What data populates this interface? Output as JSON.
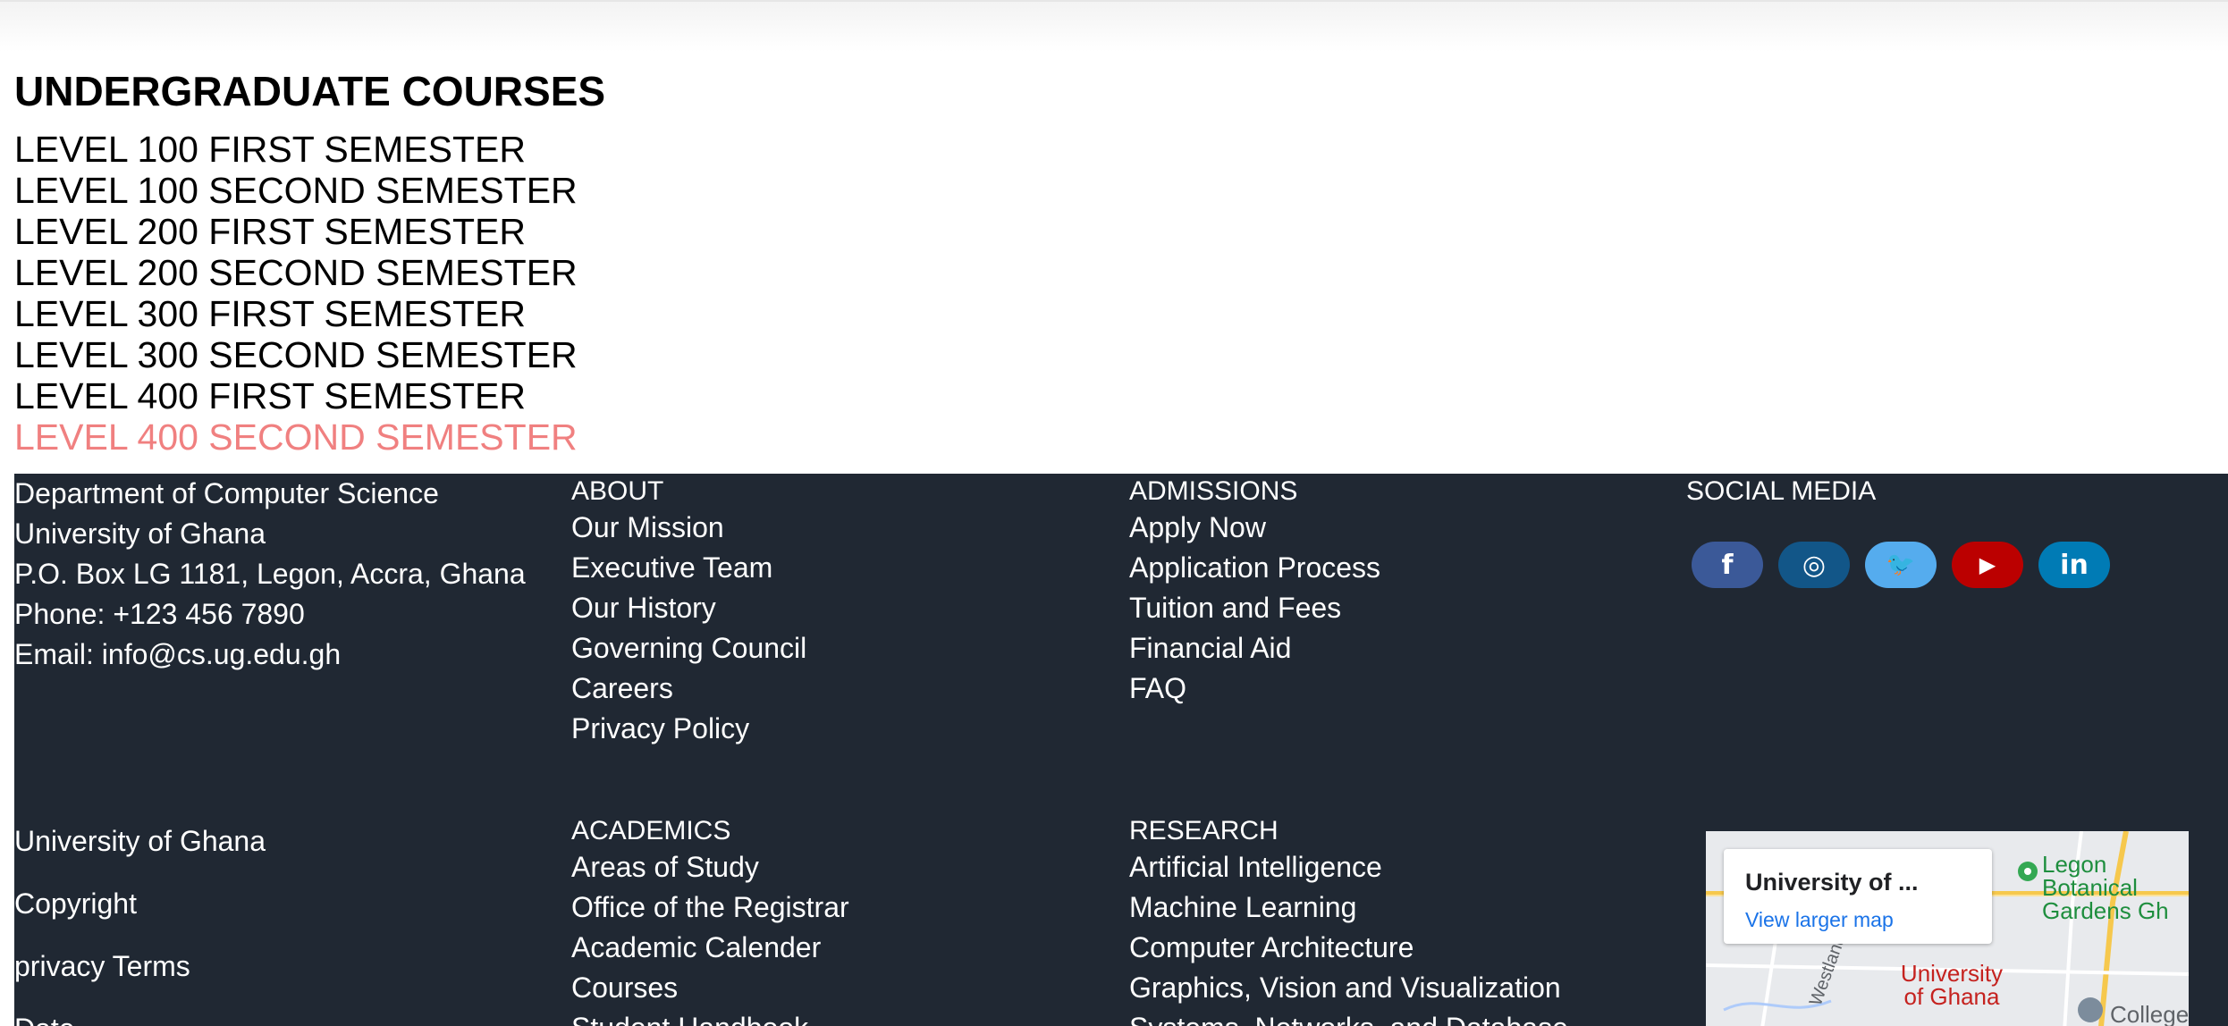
{
  "main": {
    "heading": "UNDERGRADUATE COURSES",
    "courses": [
      "LEVEL 100 FIRST SEMESTER",
      "LEVEL 100 SECOND SEMESTER",
      "LEVEL 200 FIRST SEMESTER",
      "LEVEL 200 SECOND SEMESTER",
      "LEVEL 300 FIRST SEMESTER",
      "LEVEL 300 SECOND SEMESTER",
      "LEVEL 400 FIRST SEMESTER",
      "LEVEL 400 SECOND SEMESTER"
    ],
    "hovered_course_color": "#f08080"
  },
  "footer": {
    "background": "#202833",
    "contact": {
      "lines": [
        "Department of Computer Science",
        "University of Ghana",
        "P.O. Box LG 1181, Legon, Accra, Ghana",
        "Phone: +123 456 7890",
        "Email: info@cs.ug.edu.gh"
      ]
    },
    "about": {
      "heading": "ABOUT",
      "links": [
        "Our Mission",
        "Executive Team",
        "Our History",
        "Governing Council",
        "Careers",
        "Privacy Policy"
      ]
    },
    "admissions": {
      "heading": "ADMISSIONS",
      "links": [
        "Apply Now",
        "Application Process",
        "Tuition and Fees",
        "Financial Aid",
        "FAQ"
      ]
    },
    "social": {
      "heading": "SOCIAL MEDIA",
      "items": [
        {
          "icon": "facebook-icon",
          "glyph": "f",
          "color": "#3b5998"
        },
        {
          "icon": "instagram-icon",
          "glyph": "◎",
          "color": "#125688"
        },
        {
          "icon": "twitter-icon",
          "glyph": "🐦",
          "color": "#55acee"
        },
        {
          "icon": "youtube-icon",
          "glyph": "▶",
          "color": "#bb0000"
        },
        {
          "icon": "linkedin-icon",
          "glyph": "in",
          "color": "#007bb5"
        }
      ]
    },
    "bottom_info": {
      "lines": [
        "University of Ghana",
        "Copyright",
        "privacy Terms",
        "Date"
      ]
    },
    "academics": {
      "heading": "ACADEMICS",
      "links": [
        "Areas of Study",
        "Office of the Registrar",
        "Academic Calender",
        "Courses",
        "Student Handbook"
      ]
    },
    "research": {
      "heading": "RESEARCH",
      "links": [
        "Artificial Intelligence",
        "Machine Learning",
        "Computer Architecture",
        "Graphics, Vision and Visualization",
        "Systems, Networks, and Database"
      ]
    },
    "map": {
      "card_title": "University of ...",
      "card_link": "View larger map",
      "labels": {
        "gardens": "Legon Botanical Gardens Gh",
        "street": "Westlands",
        "university": "University of Ghana",
        "college": "College"
      }
    }
  }
}
